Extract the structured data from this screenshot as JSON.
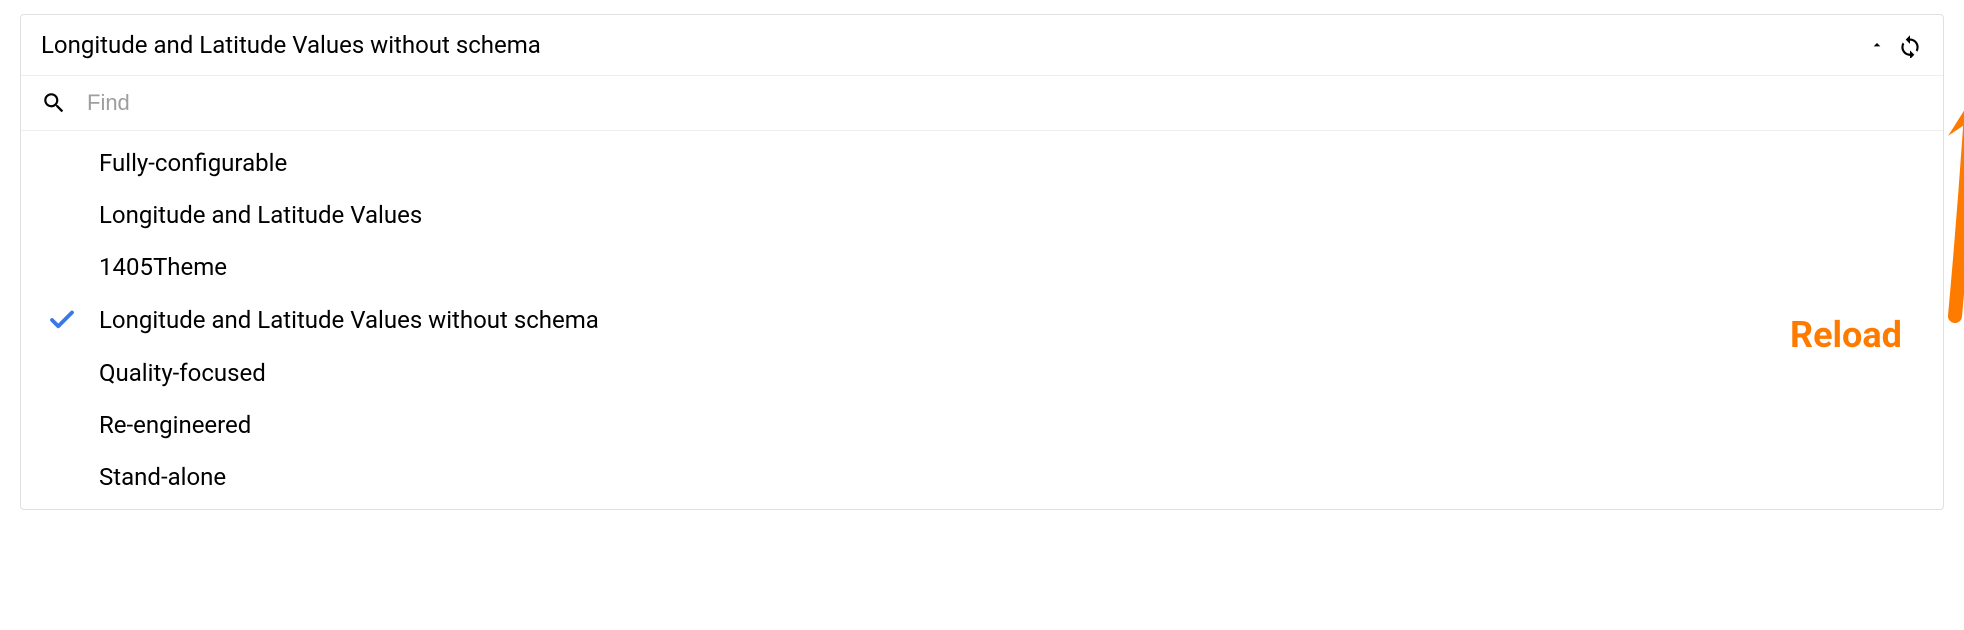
{
  "header": {
    "title": "Longitude and Latitude Values without schema"
  },
  "search": {
    "placeholder": "Find"
  },
  "options": [
    {
      "label": "Fully-configurable",
      "selected": false
    },
    {
      "label": "Longitude and Latitude Values",
      "selected": false
    },
    {
      "label": "1405Theme",
      "selected": false
    },
    {
      "label": "Longitude and Latitude Values without schema",
      "selected": true
    },
    {
      "label": "Quality-focused",
      "selected": false
    },
    {
      "label": "Re-engineered",
      "selected": false
    },
    {
      "label": "Stand-alone",
      "selected": false
    }
  ],
  "annotation": {
    "label": "Reload"
  }
}
